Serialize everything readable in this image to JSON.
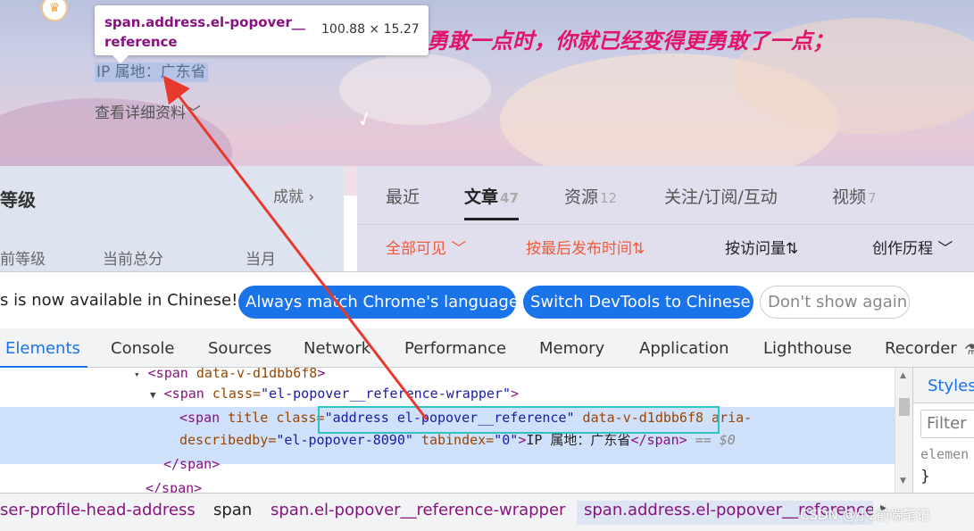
{
  "profile": {
    "ip_location": "IP 属地：广东省",
    "detail_link": "查看详细资料",
    "motto": "勇敢一点时，你就已经变得更勇敢了一点；",
    "badge": "♛"
  },
  "tooltip": {
    "selector": "span.address.el-popover__reference",
    "size": "100.88 × 15.27"
  },
  "level_panel": {
    "title": "等级",
    "more": "成就",
    "labels": [
      "前等级",
      "当前总分",
      "当月"
    ]
  },
  "content_tabs": [
    {
      "label": "最近",
      "count": ""
    },
    {
      "label": "文章",
      "count": "47"
    },
    {
      "label": "资源",
      "count": "12"
    },
    {
      "label": "关注/订阅/互动",
      "count": ""
    },
    {
      "label": "视频",
      "count": "7"
    }
  ],
  "filters": [
    {
      "label": "全部可见",
      "color": "#f05a3a"
    },
    {
      "label": "按最后发布时间⇅",
      "color": "#f05a3a"
    },
    {
      "label": "按访问量⇅",
      "color": "#222222"
    },
    {
      "label": "创作历程",
      "color": "#222222"
    }
  ],
  "infobar": {
    "message": "s is now available in Chinese!",
    "btn_match": "Always match Chrome's language",
    "btn_switch": "Switch DevTools to Chinese",
    "btn_dismiss": "Don't show again"
  },
  "devtools_tabs": [
    "Elements",
    "Console",
    "Sources",
    "Network",
    "Performance",
    "Memory",
    "Application",
    "Lighthouse",
    "Recorder"
  ],
  "dom": {
    "line0": {
      "tag_open": "<span",
      "attr": " data-v-d1dbb6f8",
      "close": ">"
    },
    "line1": {
      "tag_open": "<span",
      "attr": " class=",
      "val": "\"el-popover__reference-wrapper\"",
      "close": ">"
    },
    "line2": {
      "tag_open": "<span",
      "attr1": " title class=",
      "val1": "\"address el-popover__reference\"",
      "attr2": " data-v-d1dbb6f8 aria-"
    },
    "line3": {
      "attr": "describedby=",
      "val": "\"el-popover-8090\"",
      "attr2": " tabindex=",
      "val2": "\"0\"",
      "tag": ">",
      "text": "IP 属地：广东省",
      "close": "</span>",
      "ref": " == $0"
    },
    "line4": "</span>",
    "line5": "</span>"
  },
  "styles_panel": {
    "tab": "Styles",
    "filter_placeholder": "Filter",
    "element_style": "elemen",
    "brace": "}"
  },
  "breadcrumbs": [
    "ser-profile-head-address",
    "span",
    "span.el-popover__reference-wrapper",
    "span.address.el-popover__reference"
  ],
  "watermark": "CSDN @小z前端笔记",
  "colors": {
    "devtools_blue": "#1a73e8",
    "highlight": "#2ec4c4",
    "arrow": "#e8392f",
    "tag": "#881280"
  }
}
